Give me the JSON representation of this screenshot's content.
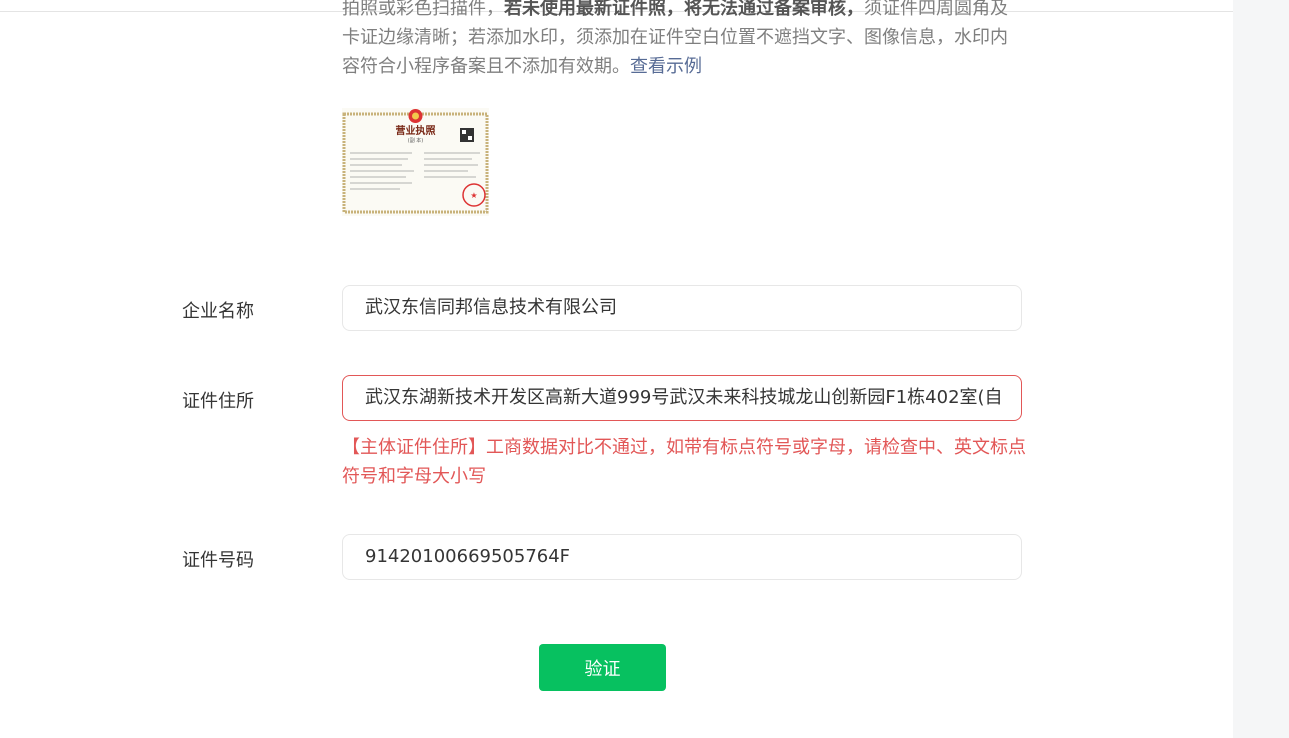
{
  "intro": {
    "line1_plain_a": "拍照或彩色扫描件，",
    "line1_bold": "若未使用最新证件照，将无法通过备案审核，",
    "line1_plain_b": "须证件四周圆角及",
    "line2": "卡证边缘清晰；若添加水印，须添加在证件空白位置不遮挡文字、图像信息，水印内",
    "line3": "容符合小程序备案且不添加有效期。",
    "example_link": "查看示例"
  },
  "license_image": {
    "title": "营业执照",
    "subtitle": "(副 本)",
    "colors": {
      "frame": "#c8b27a",
      "seal": "#d33"
    }
  },
  "form": {
    "company_name": {
      "label": "企业名称",
      "value": "武汉东信同邦信息技术有限公司"
    },
    "address": {
      "label": "证件住所",
      "value": "武汉东湖新技术开发区高新大道999号武汉未来科技城龙山创新园F1栋402室(自",
      "error": "【主体证件住所】工商数据对比不通过，如带有标点符号或字母，请检查中、英文标点符号和字母大小写"
    },
    "id_number": {
      "label": "证件号码",
      "value": "91420100669505764F"
    }
  },
  "actions": {
    "verify_label": "验证"
  },
  "colors": {
    "primary": "#07c160",
    "error": "#e25757",
    "link": "#576b95"
  }
}
